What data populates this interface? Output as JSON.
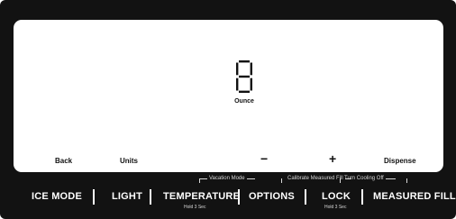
{
  "display": {
    "digit": "8",
    "unit": "Ounce"
  },
  "softkeys": {
    "back": "Back",
    "units": "Units",
    "minus": "−",
    "plus": "+",
    "dispense": "Dispense"
  },
  "hints": {
    "vacation_mode": "Vacation Mode",
    "calibrate": "Calibrate Measured Fill",
    "cooling_off": "Turn Cooling Off"
  },
  "buttons": {
    "ice_mode": "ICE MODE",
    "light": "LIGHT",
    "temperature": "TEMPERATURE",
    "temperature_sub": "Hold 3 Sec",
    "options": "OPTIONS",
    "lock": "LOCK",
    "lock_sub": "Hold 3 Sec",
    "measured_fill": "MEASURED FILL"
  },
  "colors": {
    "panel": "#121212",
    "screen": "#ffffff",
    "text_light": "#ffffff",
    "hint": "#d8d8d8"
  }
}
